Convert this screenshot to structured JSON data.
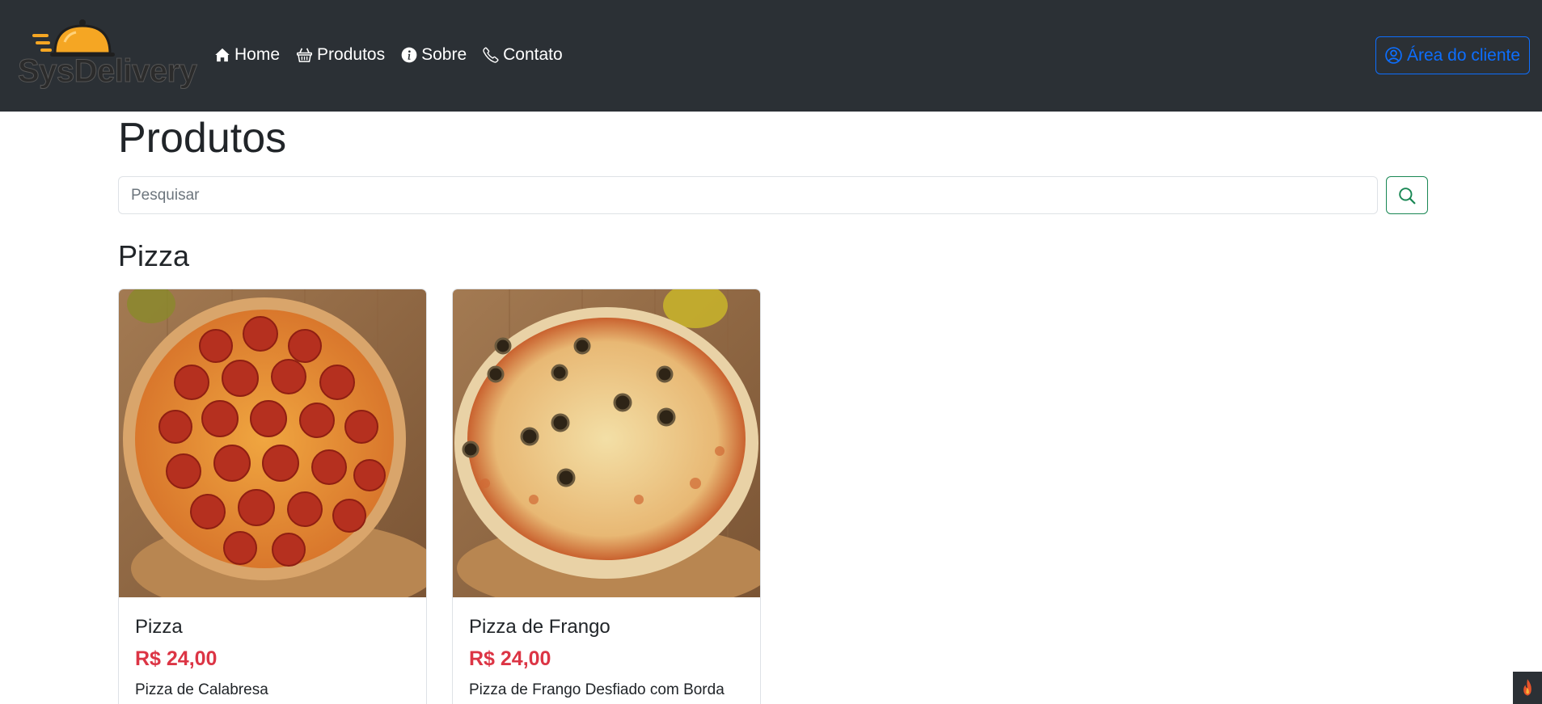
{
  "brand": {
    "name": "SysDelivery"
  },
  "nav": {
    "items": [
      {
        "label": "Home",
        "icon": "house-icon"
      },
      {
        "label": "Produtos",
        "icon": "basket-icon"
      },
      {
        "label": "Sobre",
        "icon": "info-circle-icon"
      },
      {
        "label": "Contato",
        "icon": "phone-icon"
      }
    ],
    "client_area_label": "Área do cliente",
    "client_area_icon": "person-circle-icon"
  },
  "page": {
    "title": "Produtos",
    "search": {
      "placeholder": "Pesquisar",
      "value": ""
    }
  },
  "categories": [
    {
      "name": "Pizza",
      "products": [
        {
          "name": "Pizza",
          "price": "R$ 24,00",
          "description": "Pizza de Calabresa"
        },
        {
          "name": "Pizza de Frango",
          "price": "R$ 24,00",
          "description": "Pizza de Frango Desfiado com Borda"
        }
      ]
    }
  ],
  "colors": {
    "navbar_bg": "#2b3035",
    "primary": "#0d6efd",
    "success": "#198754",
    "price": "#dc3545",
    "logo_orange": "#f5a623"
  }
}
